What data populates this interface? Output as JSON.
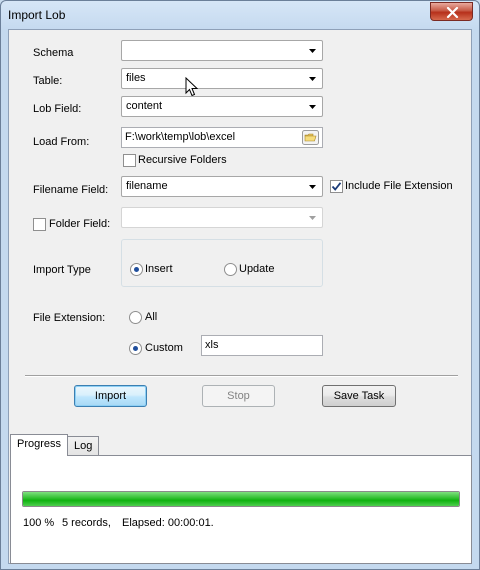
{
  "window": {
    "title": "Import Lob"
  },
  "form": {
    "schema": {
      "label": "Schema",
      "value": ""
    },
    "table": {
      "label": "Table:",
      "value": "files"
    },
    "lob_field": {
      "label": "Lob Field:",
      "value": "content"
    },
    "load_from": {
      "label": "Load From:",
      "value": "F:\\work\\temp\\lob\\excel"
    },
    "recursive_folders": {
      "label": "Recursive Folders",
      "checked": false
    },
    "filename_field": {
      "label": "Filename Field:",
      "value": "filename"
    },
    "include_file_extension": {
      "label": "Include File Extension",
      "checked": true
    },
    "folder_field": {
      "label": "Folder Field:",
      "checked": false,
      "value": ""
    },
    "import_type": {
      "label": "Import Type",
      "options": [
        {
          "label": "Insert",
          "selected": true
        },
        {
          "label": "Update",
          "selected": false
        }
      ]
    },
    "file_extension": {
      "label": "File Extension:",
      "options": [
        {
          "label": "All",
          "selected": false
        },
        {
          "label": "Custom",
          "selected": true
        }
      ],
      "custom_value": "xls"
    }
  },
  "buttons": {
    "import": "Import",
    "stop": "Stop",
    "save_task": "Save Task"
  },
  "tabs": [
    {
      "label": "Progress",
      "active": true
    },
    {
      "label": "Log",
      "active": false
    }
  ],
  "progress": {
    "fraction": 1.0,
    "percent_text": "100 %",
    "records_text": "5 records,",
    "elapsed_text": "Elapsed: 00:00:01."
  },
  "colors": {
    "progress_fill": "#1fb81f",
    "title_bar": "#c4d9ef",
    "close_button": "#c75a46"
  }
}
